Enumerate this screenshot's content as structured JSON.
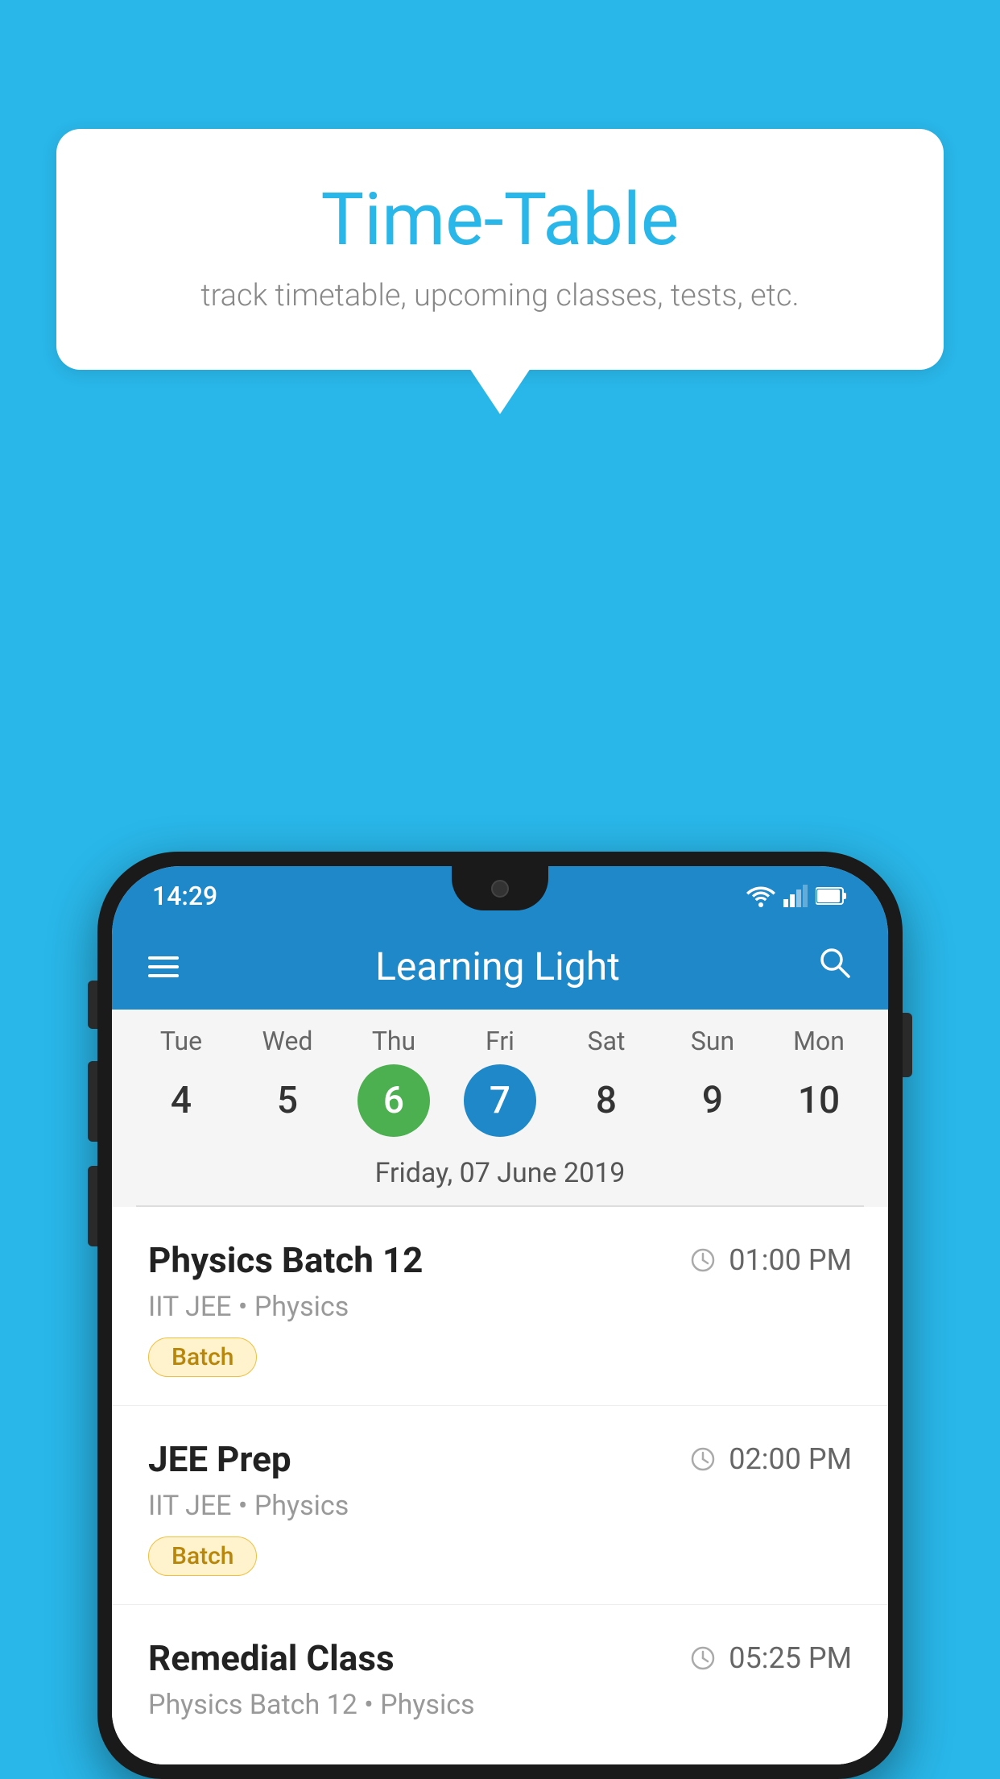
{
  "background_color": "#29b6e8",
  "bubble": {
    "title": "Time-Table",
    "subtitle": "track timetable, upcoming classes, tests, etc."
  },
  "status_bar": {
    "time": "14:29"
  },
  "app_header": {
    "title": "Learning Light"
  },
  "calendar": {
    "days": [
      {
        "name": "Tue",
        "num": "4",
        "state": "normal"
      },
      {
        "name": "Wed",
        "num": "5",
        "state": "normal"
      },
      {
        "name": "Thu",
        "num": "6",
        "state": "today"
      },
      {
        "name": "Fri",
        "num": "7",
        "state": "selected"
      },
      {
        "name": "Sat",
        "num": "8",
        "state": "normal"
      },
      {
        "name": "Sun",
        "num": "9",
        "state": "normal"
      },
      {
        "name": "Mon",
        "num": "10",
        "state": "normal"
      }
    ],
    "selected_date_label": "Friday, 07 June 2019"
  },
  "schedule": [
    {
      "title": "Physics Batch 12",
      "time": "01:00 PM",
      "subtitle": "IIT JEE • Physics",
      "badge": "Batch"
    },
    {
      "title": "JEE Prep",
      "time": "02:00 PM",
      "subtitle": "IIT JEE • Physics",
      "badge": "Batch"
    },
    {
      "title": "Remedial Class",
      "time": "05:25 PM",
      "subtitle": "Physics Batch 12 • Physics",
      "badge": null
    }
  ]
}
